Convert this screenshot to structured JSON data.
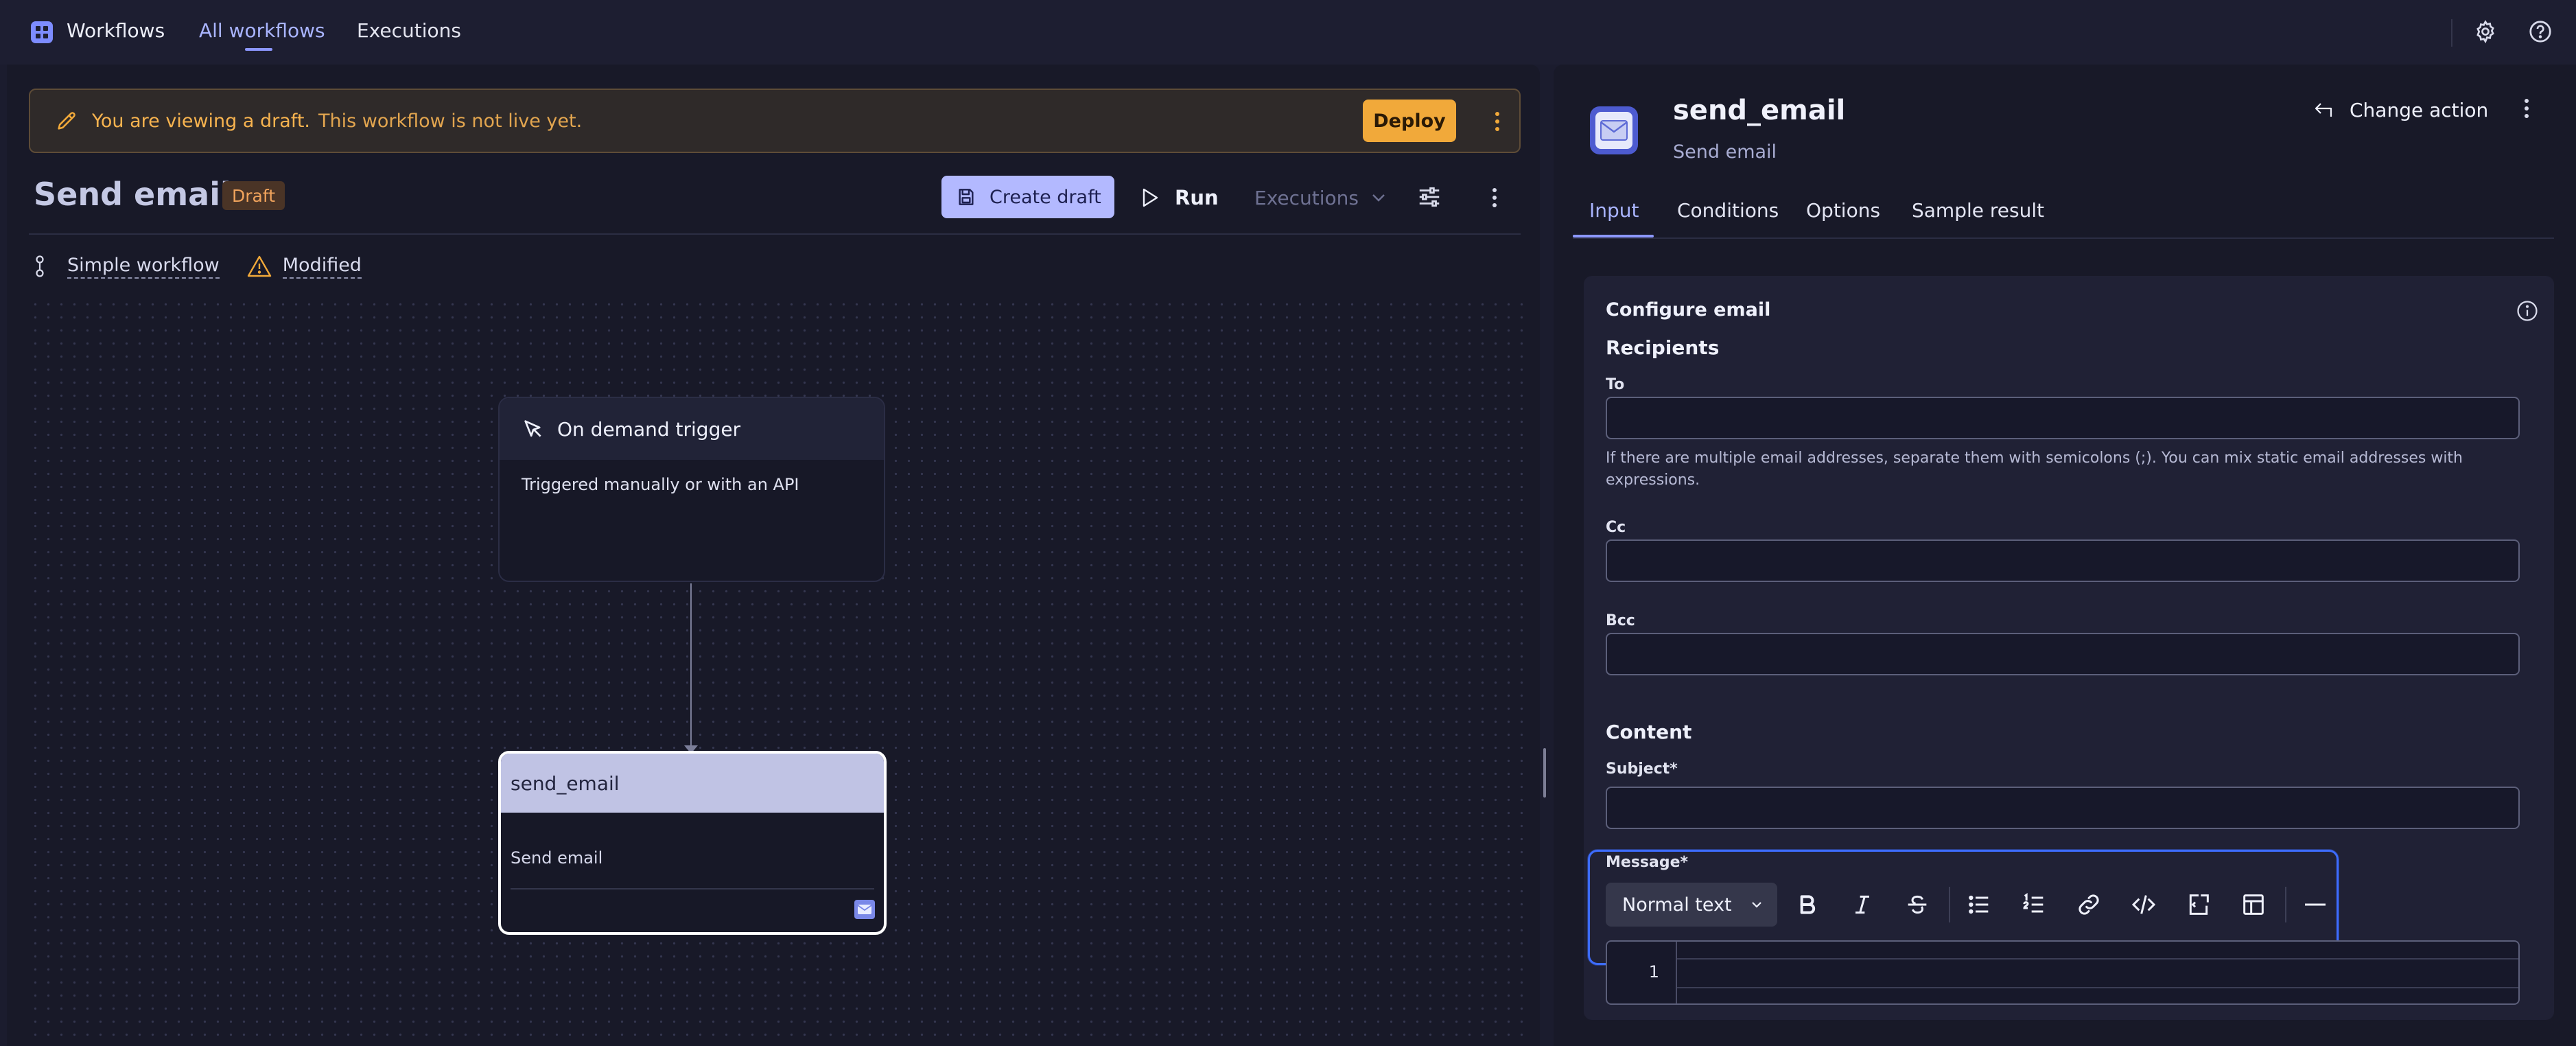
{
  "topnav": {
    "app_name": "Workflows",
    "tabs": [
      {
        "label": "All workflows",
        "active": true
      },
      {
        "label": "Executions",
        "active": false
      }
    ],
    "icons": [
      "settings-icon",
      "help-icon"
    ]
  },
  "banner": {
    "message": "You are viewing a draft.",
    "sub": "This workflow is not live yet.",
    "deploy_label": "Deploy"
  },
  "workflow": {
    "title": "Send email",
    "badge": "Draft",
    "create_draft_label": "Create draft",
    "run_label": "Run",
    "executions_label": "Executions",
    "type_label": "Simple workflow",
    "status_label": "Modified"
  },
  "canvas": {
    "trigger": {
      "title": "On demand trigger",
      "description": "Triggered manually or with an API"
    },
    "action": {
      "title": "send_email",
      "description": "Send email"
    }
  },
  "panel": {
    "name": "send_email",
    "subtitle": "Send email",
    "change_action_label": "Change action",
    "tabs": [
      {
        "label": "Input",
        "active": true
      },
      {
        "label": "Conditions",
        "active": false
      },
      {
        "label": "Options",
        "active": false
      },
      {
        "label": "Sample result",
        "active": false
      }
    ]
  },
  "form": {
    "title": "Configure email",
    "recipients_label": "Recipients",
    "to_label": "To",
    "to_value": "",
    "helper": "If there are multiple email addresses, separate them with semicolons (;). You can mix static email addresses with expressions.",
    "cc_label": "Cc",
    "cc_value": "",
    "bcc_label": "Bcc",
    "bcc_value": "",
    "content_label": "Content",
    "subject_label": "Subject*",
    "subject_value": "",
    "message_label": "Message*",
    "text_style": "Normal text",
    "editor_line": "1"
  },
  "colors": {
    "accent": "#8c97ff",
    "warning": "#f1a93a",
    "focus": "#3d6cff",
    "background": "#181928"
  }
}
